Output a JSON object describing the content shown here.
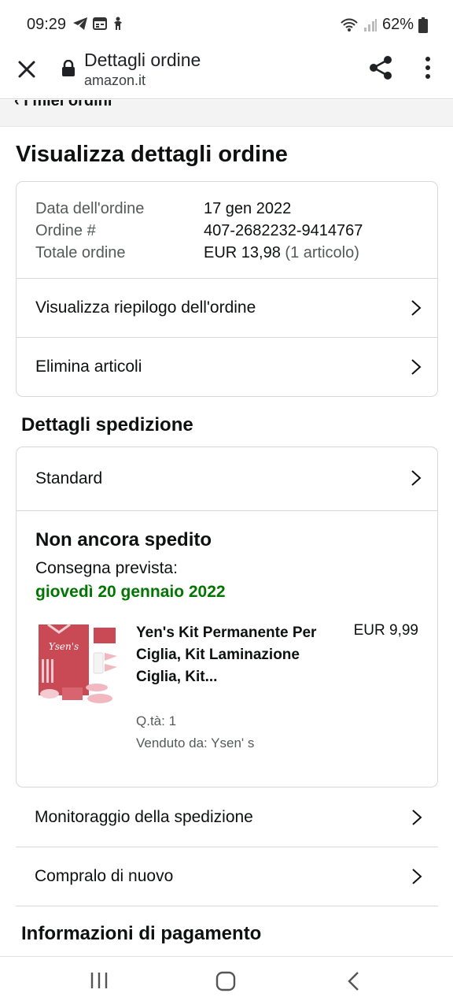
{
  "status_bar": {
    "time": "09:29",
    "battery": "62%",
    "icons": [
      "telegram-icon",
      "calendar-icon",
      "accessibility-icon",
      "wifi-icon",
      "signal-icon",
      "battery-icon"
    ]
  },
  "browser": {
    "title": "Dettagli ordine",
    "url": "amazon.it"
  },
  "breadcrumb": {
    "label": "I miei ordini"
  },
  "page_title": "Visualizza dettagli ordine",
  "order_summary": {
    "date_label": "Data dell'ordine",
    "date_value": "17 gen 2022",
    "number_label": "Ordine #",
    "number_value": "407-2682232-9414767",
    "total_label": "Totale ordine",
    "total_value": "EUR 13,98",
    "total_items": "(1 articolo)",
    "links": [
      "Visualizza riepilogo dell'ordine",
      "Elimina articoli"
    ]
  },
  "shipping": {
    "section_title": "Dettagli spedizione",
    "method": "Standard",
    "status": "Non ancora spedito",
    "delivery_label": "Consegna prevista:",
    "delivery_date": "giovedì 20 gennaio 2022",
    "product": {
      "title": "Yen's Kit Permanente Per Ciglia, Kit Laminazione Ciglia, Kit...",
      "price": "EUR 9,99",
      "qty": "Q.tà: 1",
      "seller": "Venduto da: Ysen' s",
      "image_brand_text": "Ysen's"
    }
  },
  "actions": [
    "Monitoraggio della spedizione",
    "Compralo di nuovo"
  ],
  "payment": {
    "section_title": "Informazioni di pagamento"
  },
  "colors": {
    "delivery_green": "#007600",
    "border": "#d5d9d9",
    "text": "#0f1111",
    "muted": "#565959"
  }
}
